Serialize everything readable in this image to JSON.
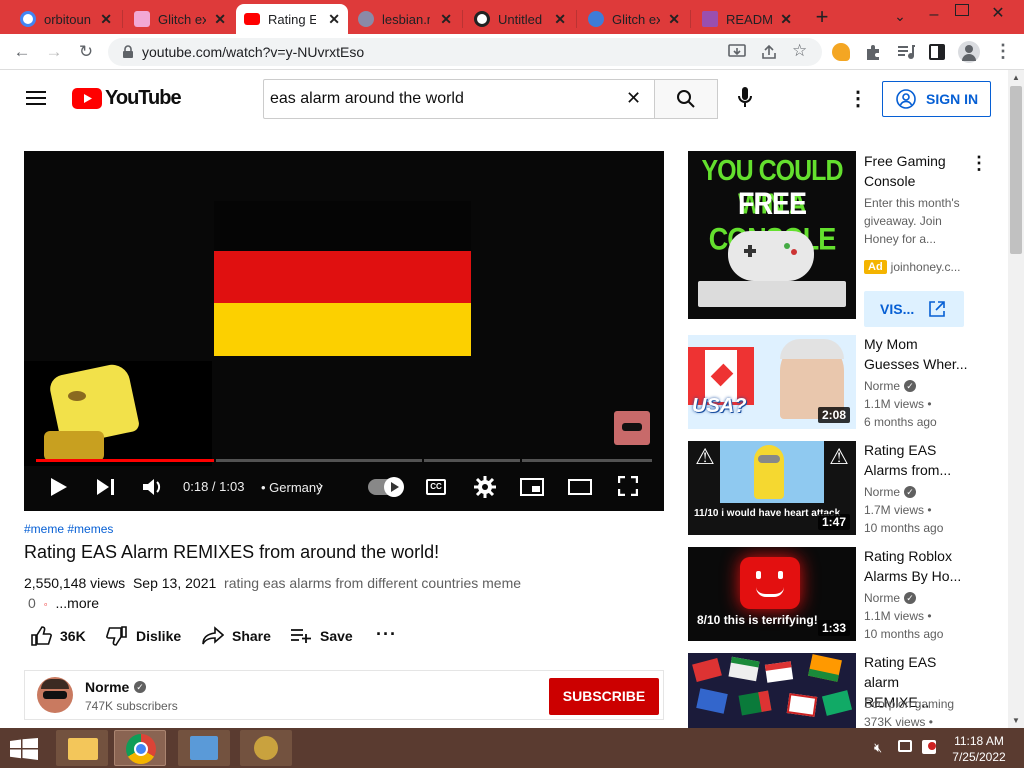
{
  "browser": {
    "tabs": [
      {
        "label": "orbitoun",
        "color": "#4285f4"
      },
      {
        "label": "Glitch ex",
        "color": "#f2a8d4"
      },
      {
        "label": "Rating EA",
        "color": "#ff0000"
      },
      {
        "label": "lesbian.m",
        "color": "#8a8aa8"
      },
      {
        "label": "Untitled",
        "color": "#222"
      },
      {
        "label": "Glitch ex",
        "color": "#3f7cd8"
      },
      {
        "label": "READMI",
        "color": "#9a4fb0"
      }
    ],
    "url": "youtube.com/watch?v=y-NUvrxtEso"
  },
  "youtube": {
    "logo_text": "YouTube",
    "search_value": "eas alarm around the world",
    "sign_in": "SIGN IN",
    "player": {
      "time": "0:18 / 1:03",
      "chapter": "• Germany",
      "progress_fraction": 0.29
    },
    "video": {
      "hashtags": "#meme #memes",
      "title": "Rating EAS Alarm REMIXES from around the world!",
      "views": "2,550,148 views",
      "date": "Sep 13, 2021",
      "description": "rating eas alarms from different countries meme",
      "desc_count": "0",
      "more": "...more",
      "like_count": "36K",
      "dislike": "Dislike",
      "share": "Share",
      "save": "Save"
    },
    "channel": {
      "name": "Norme",
      "subscribers": "747K subscribers",
      "subscribe": "SUBSCRIBE"
    },
    "ad": {
      "thumb_line1": "YOU COULD WIN A",
      "thumb_line2a": "FREE ",
      "thumb_line2b": "CONSOLE",
      "title": "Free Gaming Console",
      "desc": "Enter this month's giveaway. Join Honey for a...",
      "badge": "Ad",
      "domain": "joinhoney.c...",
      "visit": "VIS..."
    },
    "sidebar": [
      {
        "title": "My Mom Guesses Wher...",
        "channel": "Norme",
        "views": "1.1M views •",
        "age": "6 months ago",
        "duration": "2:08",
        "overlay": "USA?"
      },
      {
        "title": "Rating EAS Alarms from...",
        "channel": "Norme",
        "views": "1.7M views •",
        "age": "10 months ago",
        "duration": "1:47",
        "overlay": "11/10 i would have heart attack"
      },
      {
        "title": "Rating Roblox Alarms By Ho...",
        "channel": "Norme",
        "views": "1.1M views •",
        "age": "10 months ago",
        "duration": "1:33",
        "overlay": "8/10 this is terrifying!"
      },
      {
        "title": "Rating EAS alarm REMIXE...",
        "channel": "Scorpion gaming",
        "views": "373K views •",
        "age": "",
        "duration": "",
        "overlay": ""
      }
    ]
  },
  "taskbar": {
    "time": "11:18 AM",
    "date": "7/25/2022"
  },
  "colors": {
    "tabbar": "#de3a3a",
    "youtube_red": "#ff0000",
    "subscribe_red": "#cc0000",
    "link_blue": "#065fd4",
    "taskbar": "#5a3b30"
  }
}
